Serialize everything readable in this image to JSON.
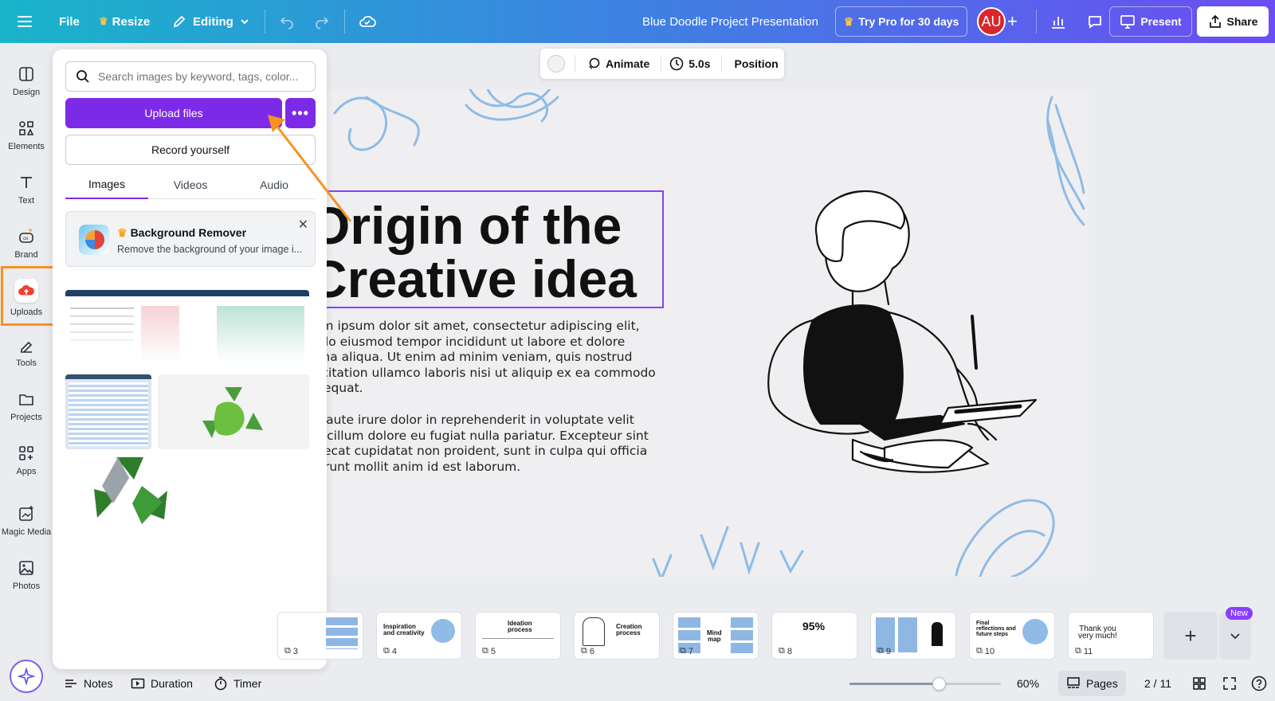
{
  "topbar": {
    "file": "File",
    "resize": "Resize",
    "editing": "Editing",
    "doc_title": "Blue Doodle Project Presentation",
    "try_pro": "Try Pro for 30 days",
    "avatar": "AU",
    "present": "Present",
    "share": "Share"
  },
  "rail": [
    {
      "label": "Design",
      "icon": "design-icon"
    },
    {
      "label": "Elements",
      "icon": "elements-icon"
    },
    {
      "label": "Text",
      "icon": "text-icon"
    },
    {
      "label": "Brand",
      "icon": "brand-icon"
    },
    {
      "label": "Uploads",
      "icon": "cloud-upload-icon"
    },
    {
      "label": "Tools",
      "icon": "tools-icon"
    },
    {
      "label": "Projects",
      "icon": "folder-icon"
    },
    {
      "label": "Apps",
      "icon": "apps-icon"
    },
    {
      "label": "Magic Media",
      "icon": "magic-media-icon"
    },
    {
      "label": "Photos",
      "icon": "photos-icon"
    }
  ],
  "panel": {
    "search_placeholder": "Search images by keyword, tags, color...",
    "upload": "Upload files",
    "record": "Record yourself",
    "tabs": [
      "Images",
      "Videos",
      "Audio"
    ],
    "bg_remover_title": "Background Remover",
    "bg_remover_desc": "Remove the background of your image i..."
  },
  "ctx": {
    "animate": "Animate",
    "duration": "5.0s",
    "position": "Position"
  },
  "slide": {
    "title_line1": "Origin of the",
    "title_line2": "Creative idea",
    "para1": "Lorem ipsum dolor sit amet, consectetur adipiscing elit,\nsed do eiusmod tempor incididunt ut labore et dolore\nmagna aliqua. Ut enim ad minim veniam, quis nostrud\nexercitation ullamco laboris nisi ut aliquip ex ea commodo\nconsequat.",
    "para2": "Duis aute irure dolor in reprehenderit in voluptate velit\nesse cillum dolore eu fugiat nulla pariatur. Excepteur sint\noccaecat cupidatat non proident, sunt in culpa qui officia\ndeserunt mollit anim id est laborum."
  },
  "pages": [
    {
      "num": "3",
      "title": ""
    },
    {
      "num": "4",
      "title": "Inspiration\nand creativity"
    },
    {
      "num": "5",
      "title": "Ideation\nprocess"
    },
    {
      "num": "6",
      "title": "Creation\nprocess"
    },
    {
      "num": "7",
      "title": "Mind\nmap"
    },
    {
      "num": "8",
      "title": "95%"
    },
    {
      "num": "9",
      "title": ""
    },
    {
      "num": "10",
      "title": "Final\nreflections and\nfuture steps"
    },
    {
      "num": "11",
      "title": "Thank you\nvery much!"
    }
  ],
  "new_badge": "New",
  "bottom": {
    "notes": "Notes",
    "duration": "Duration",
    "timer": "Timer",
    "zoom": "60%",
    "zoom_level": 0.6,
    "pages": "Pages",
    "page_count": "2 / 11"
  },
  "colors": {
    "accent": "#7d2ae8",
    "highlight": "#f7931e",
    "doodle": "#8fbbe6"
  }
}
